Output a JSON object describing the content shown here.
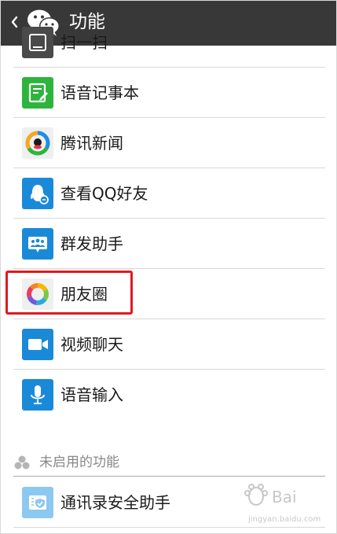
{
  "header": {
    "title": "功能",
    "back_icon": "chevron-left-icon",
    "logo_icon": "wechat-logo-icon",
    "bg": "#383838"
  },
  "list": {
    "partial_item": {
      "label": "扫一扫",
      "icon": "scan-icon"
    },
    "items": [
      {
        "label": "语音记事本",
        "icon": "voice-notepad-icon",
        "color": "#2db43c"
      },
      {
        "label": "腾讯新闻",
        "icon": "tencent-news-icon",
        "color": "#f0f0f0"
      },
      {
        "label": "查看QQ好友",
        "icon": "qq-friends-icon",
        "color": "#1a8ad8"
      },
      {
        "label": "群发助手",
        "icon": "mass-send-icon",
        "color": "#1a8ad8"
      },
      {
        "label": "朋友圈",
        "icon": "moments-icon",
        "color": "#f0f0f0"
      },
      {
        "label": "视频聊天",
        "icon": "video-chat-icon",
        "color": "#1a8ad8"
      },
      {
        "label": "语音输入",
        "icon": "voice-input-icon",
        "color": "#1a8ad8"
      }
    ]
  },
  "disabled_section": {
    "title": "未启用的功能",
    "items": [
      {
        "label": "通讯录安全助手",
        "icon": "contacts-security-icon",
        "color": "#8cc8f0"
      }
    ]
  },
  "highlight_color": "#e0191f",
  "watermark": {
    "icon": "baidu-jingyan-watermark-icon",
    "text": "jingyan.baidu.com"
  }
}
